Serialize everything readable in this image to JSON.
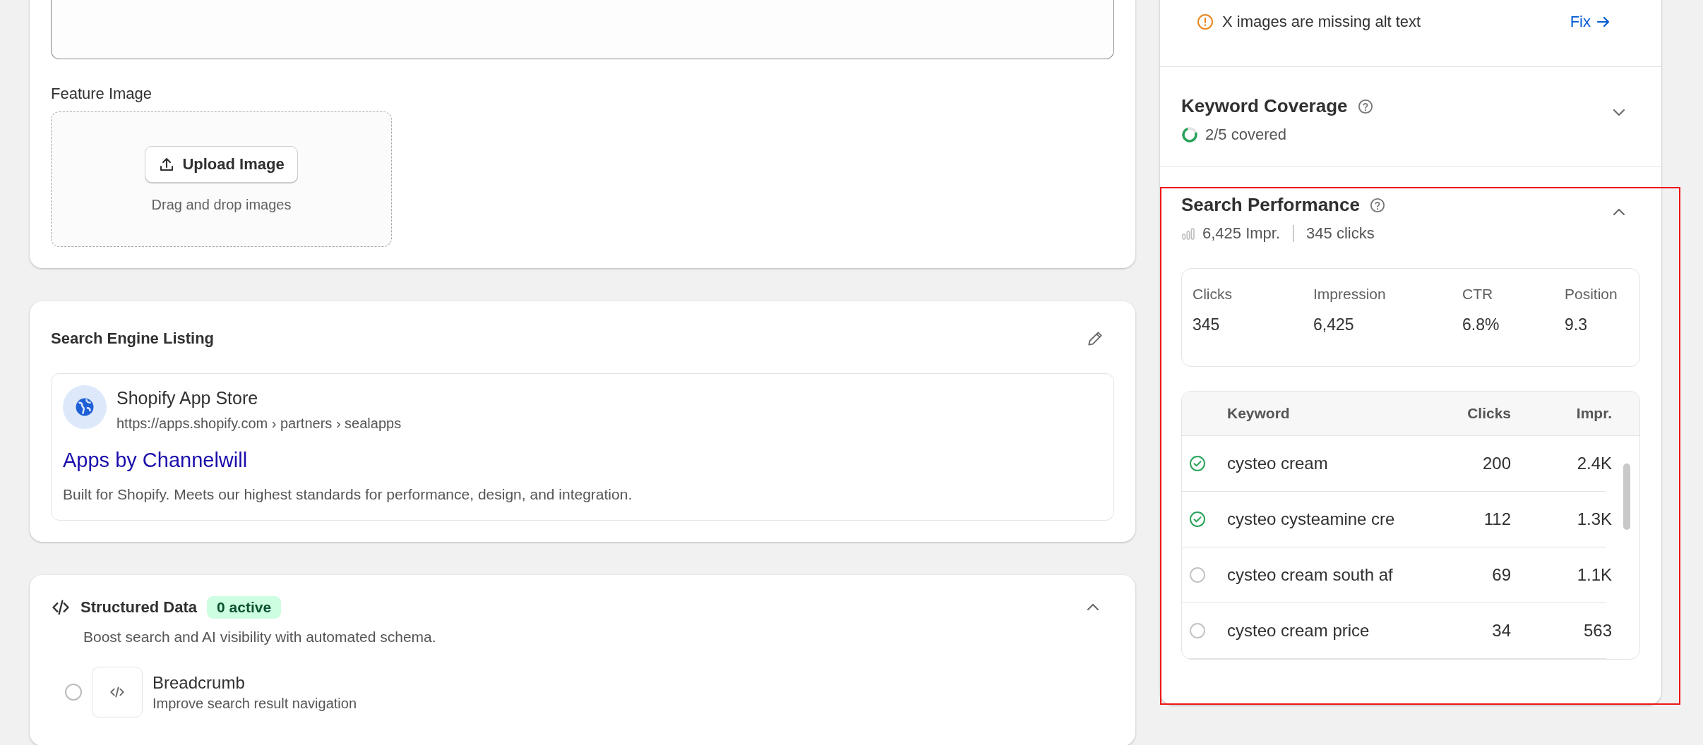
{
  "feature_image": {
    "label": "Feature Image",
    "button": "Upload Image",
    "hint": "Drag and drop images"
  },
  "search_listing": {
    "title": "Search Engine Listing",
    "site_name": "Shopify App Store",
    "url": "https://apps.shopify.com › partners › sealapps",
    "headline": "Apps by Channelwill",
    "description": "Built for Shopify. Meets our highest standards for performance, design, and integration."
  },
  "structured_data": {
    "title": "Structured Data",
    "badge": "0 active",
    "expanded": true,
    "subtitle": "Boost search and AI visibility with automated schema.",
    "items": [
      {
        "name": "Breadcrumb",
        "description": "Improve search result navigation",
        "checked": false
      }
    ]
  },
  "sidebar": {
    "alert": {
      "text": "X images are missing alt text",
      "action": "Fix"
    },
    "keyword_coverage": {
      "title": "Keyword Coverage",
      "expanded": false,
      "level": 0.75,
      "summary": "2/5 covered"
    },
    "search_performance": {
      "title": "Search Performance",
      "expanded": true,
      "highlighted": true,
      "impressions": "6,425 Impr.",
      "clicks": "345 clicks",
      "metrics": [
        {
          "label": "Clicks",
          "value": "345"
        },
        {
          "label": "Impression",
          "value": "6,425"
        },
        {
          "label": "CTR",
          "value": "6.8%"
        },
        {
          "label": "Position",
          "value": "9.3"
        }
      ],
      "columns": [
        "Keyword",
        "Clicks",
        "Impr."
      ],
      "rows": [
        {
          "covered": true,
          "keyword": "cysteo cream",
          "clicks": "200",
          "impr": "2.4K"
        },
        {
          "covered": true,
          "keyword": "cysteo cysteamine cre",
          "clicks": "112",
          "impr": "1.3K"
        },
        {
          "covered": false,
          "keyword": "cysteo cream south af",
          "clicks": "69",
          "impr": "1.1K"
        },
        {
          "covered": false,
          "keyword": "cysteo cream price",
          "clicks": "34",
          "impr": "563"
        }
      ]
    }
  }
}
